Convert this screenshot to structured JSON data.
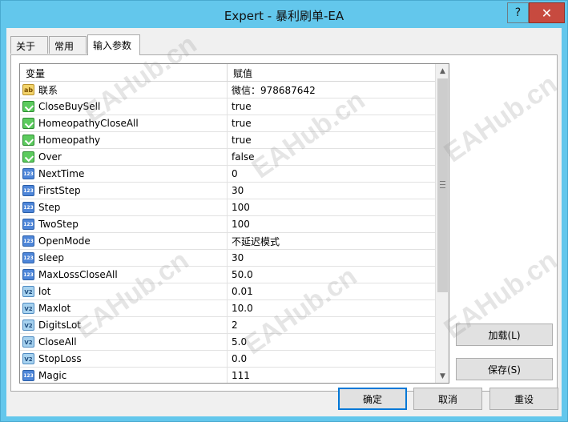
{
  "window": {
    "title": "Expert - 暴利刷单-EA",
    "help": "?",
    "close": "✕"
  },
  "tabs": [
    {
      "label": "关于"
    },
    {
      "label": "常用"
    },
    {
      "label": "输入参数"
    }
  ],
  "grid": {
    "headers": {
      "variable": "变量",
      "value": "赋值"
    },
    "rows": [
      {
        "type": "ab",
        "name": "联系",
        "value": "微信：978687642"
      },
      {
        "type": "bool",
        "name": "CloseBuySell",
        "value": "true"
      },
      {
        "type": "bool",
        "name": "HomeopathyCloseAll",
        "value": "true"
      },
      {
        "type": "bool",
        "name": "Homeopathy",
        "value": "true"
      },
      {
        "type": "bool",
        "name": "Over",
        "value": "false"
      },
      {
        "type": "int",
        "name": "NextTime",
        "value": "0"
      },
      {
        "type": "int",
        "name": "FirstStep",
        "value": "30"
      },
      {
        "type": "int",
        "name": "Step",
        "value": "100"
      },
      {
        "type": "int",
        "name": "TwoStep",
        "value": "100"
      },
      {
        "type": "int",
        "name": "OpenMode",
        "value": "不延迟模式"
      },
      {
        "type": "int",
        "name": "sleep",
        "value": "30"
      },
      {
        "type": "int",
        "name": "MaxLossCloseAll",
        "value": "50.0"
      },
      {
        "type": "dbl",
        "name": "lot",
        "value": "0.01"
      },
      {
        "type": "dbl",
        "name": "Maxlot",
        "value": "10.0"
      },
      {
        "type": "dbl",
        "name": "DigitsLot",
        "value": "2"
      },
      {
        "type": "dbl",
        "name": "CloseAll",
        "value": "5.0"
      },
      {
        "type": "dbl",
        "name": "StopLoss",
        "value": "0.0"
      },
      {
        "type": "int",
        "name": "Magic",
        "value": "111"
      }
    ],
    "icon_labels": {
      "ab": "ab",
      "int": "123",
      "dbl": "V2"
    }
  },
  "side_buttons": {
    "load": "加载(L)",
    "save": "保存(S)"
  },
  "bottom_buttons": {
    "ok": "确定",
    "cancel": "取消",
    "reset": "重设"
  },
  "watermark": "EAHub.cn",
  "colors": {
    "titlebar": "#63c7ec",
    "close": "#c74a3f",
    "accent": "#0078d7"
  }
}
